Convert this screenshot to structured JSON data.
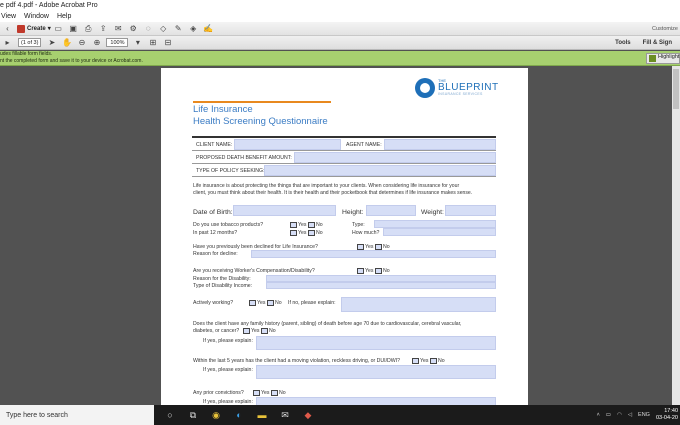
{
  "window": {
    "title": "e pdf 4.pdf - Adobe Acrobat Pro",
    "menu": [
      "View",
      "Window",
      "Help"
    ]
  },
  "toolbar": {
    "create_label": "Create",
    "customize_label": "Customize"
  },
  "nav": {
    "page_indicator": "(1 of 3)",
    "zoom": "100%",
    "tools_label": "Tools",
    "fill_sign_label": "Fill & Sign"
  },
  "infobar": {
    "line1": "udes fillable form fields.",
    "line2": "nt the completed form and save it to your device or Acrobat.com.",
    "highlight_label": "Highlight"
  },
  "form": {
    "logo": {
      "the": "THE",
      "name": "BLUEPRINT",
      "sub": "INSURANCE SERVICES"
    },
    "title_line1": "Life Insurance",
    "title_line2": "Health Screening Questionnaire",
    "client_name_label": "CLIENT NAME:",
    "agent_name_label": "AGENT NAME:",
    "proposed_benefit_label": "PROPOSED DEATH BENEFIT AMOUNT:",
    "policy_type_label": "TYPE OF POLICY SEEKING:",
    "intro_line1": "Life insurance is about protecting the things that are important to your clients. When considering life insurance for your",
    "intro_line2": "client, you must think about their health. It is their health and their pocketbook that determines if life insurance makes sense.",
    "dob_label": "Date of Birth:",
    "height_label": "Height:",
    "weight_label": "Weight:",
    "tobacco_q": "Do you use tobacco products?",
    "tobacco_past": "In past 12 months?",
    "type_label": "Type:",
    "how_much_label": "How much?",
    "yes": "Yes",
    "no": "No",
    "declined_q": "Have you previously been declined for Life Insurance?",
    "reason_decline": "Reason for decline:",
    "workers_comp_q": "Are you receiving Worker's Compensation/Disability?",
    "reason_disability": "Reason for the Disability:",
    "type_disability_income": "Type of Disability Income:",
    "actively_working_q": "Actively working?",
    "if_no_explain": "If no, please explain:",
    "family_history_line1": "Does the client have any family history (parent, sibling) of death before age 70 due to cardiovascular, cerebral vascular,",
    "family_history_line2": "diabetes, or cancer?",
    "if_yes_explain": "If yes, please explain:",
    "moving_violation_q": "Within the last 5 years has the client had a moving violation, reckless driving, or DUI/DWI?",
    "prior_convictions_q": "Any prior convictions?"
  },
  "taskbar": {
    "search_placeholder": "Type here to search",
    "language": "ENG",
    "time": "17:40",
    "date": "03-04-20"
  },
  "colors": {
    "field_fill": "#d6def6",
    "title_blue": "#3b7cc4",
    "accent_orange": "#e8891f",
    "infobar_green": "#a7d06f"
  }
}
